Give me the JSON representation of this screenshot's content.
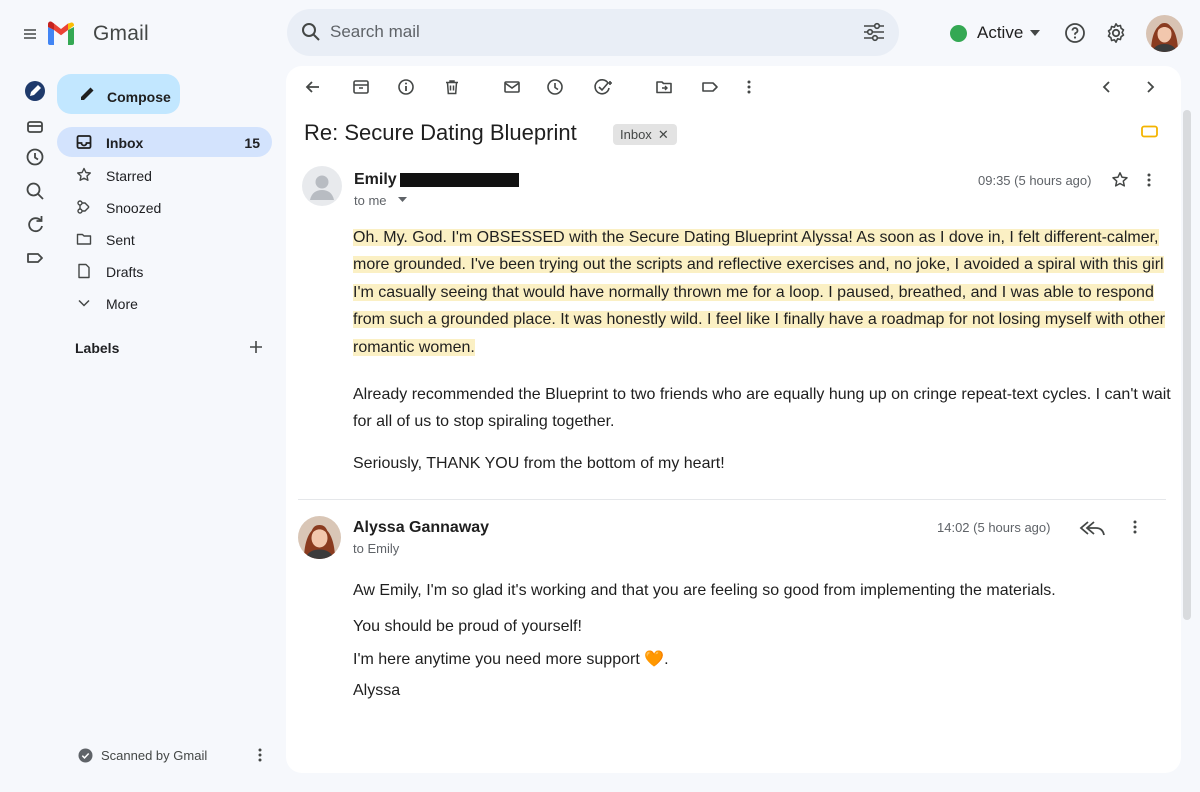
{
  "app": {
    "product_name": "Gmail"
  },
  "search": {
    "placeholder": "Search mail"
  },
  "status": {
    "label": "Active",
    "color": "#34a853"
  },
  "sidebar": {
    "compose_label": "Compose",
    "items": [
      {
        "label": "Inbox",
        "count": "15",
        "icon": "inbox-icon",
        "active": true
      },
      {
        "label": "Starred",
        "icon": "star-icon"
      },
      {
        "label": "Snoozed",
        "icon": "snooze-icon"
      },
      {
        "label": "Sent",
        "icon": "sent-folder-icon"
      },
      {
        "label": "Drafts",
        "icon": "draft-icon"
      },
      {
        "label": "More",
        "icon": "chevron-down-icon"
      }
    ],
    "labels_heading": "Labels",
    "scanned_text": "Scanned by Gmail"
  },
  "thread": {
    "subject": "Re: Secure Dating Blueprint",
    "label_chip": "Inbox",
    "messages": [
      {
        "sender": "Emily",
        "recipient": "to me",
        "time": "09:35 (5 hours ago)",
        "paragraphs": [
          "Oh. My. God. I'm OBSESSED with the Secure Dating Blueprint Alyssa! As soon as I dove in, I felt different-calmer, more grounded. I've been trying out the scripts and reflective exercises and, no joke, I avoided a spiral with this girl I'm casually seeing that would have normally thrown me for a loop. I paused, breathed, and I was able to respond from such a grounded place. It was honestly wild. I feel like I finally have a roadmap for not losing myself with other romantic women.",
          "Already recommended the Blueprint to two friends who are equally hung up on cringe repeat-text cycles. I can't wait for all of us to stop spiraling together.",
          "Seriously, THANK YOU from the bottom of my heart!"
        ]
      },
      {
        "sender": "Alyssa Gannaway",
        "recipient": "to Emily",
        "time": "14:02 (5 hours ago)",
        "lines": [
          "Aw Emily, I'm so glad it's working and that you are feeling so good from implementing the materials.",
          "You should be proud of yourself!",
          "I'm here anytime you need more support",
          "Alyssa"
        ],
        "emoji": "🧡"
      }
    ]
  },
  "colors": {
    "compose_bg": "#c2e7ff",
    "active_nav_bg": "#d3e3fd",
    "highlight": "#fbf0c4",
    "important_marker": "#f4b400"
  }
}
